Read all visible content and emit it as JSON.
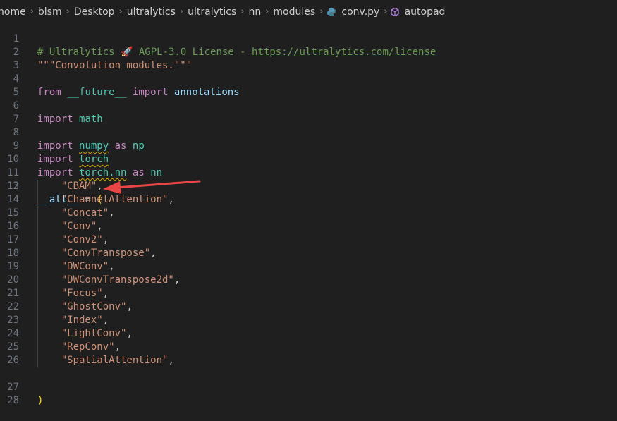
{
  "breadcrumb": {
    "items": [
      "home",
      "blsm",
      "Desktop",
      "ultralytics",
      "ultralytics",
      "nn",
      "modules"
    ],
    "file": "conv.py",
    "symbol": "autopad"
  },
  "editor": {
    "line_numbers": [
      "1",
      "2",
      "3",
      "4",
      "5",
      "6",
      "7",
      "8",
      "9",
      "10",
      "11",
      "12",
      "13",
      "14",
      "15",
      "16",
      "17",
      "18",
      "19",
      "20",
      "21",
      "22",
      "23",
      "24",
      "25",
      "26",
      "27",
      "28"
    ],
    "line1": {
      "comment_a": "# Ultralytics ",
      "emoji": "🚀",
      "comment_b": " AGPL-3.0 License - ",
      "url": "https://ultralytics.com/license"
    },
    "line2": {
      "docstring": "\"\"\"Convolution modules.\"\"\""
    },
    "line4": {
      "kw1": "from",
      "module": "__future__",
      "kw2": "import",
      "name": "annotations"
    },
    "line6": {
      "kw": "import",
      "module": "math"
    },
    "line8": {
      "kw": "import",
      "module": "numpy",
      "as": "as",
      "alias": "np"
    },
    "line9": {
      "kw": "import",
      "module": "torch"
    },
    "line10": {
      "kw": "import",
      "module": "torch.nn",
      "as": "as",
      "alias": "nn"
    },
    "line12": {
      "var": "__all__",
      "eq": " = ",
      "open": "("
    },
    "all_items": [
      "\"CBAM\"",
      "\"ChannelAttention\"",
      "\"Concat\"",
      "\"Conv\"",
      "\"Conv2\"",
      "\"ConvTranspose\"",
      "\"DWConv\"",
      "\"DWConvTranspose2d\"",
      "\"Focus\"",
      "\"GhostConv\"",
      "\"Index\"",
      "\"LightConv\"",
      "\"RepConv\"",
      "\"SpatialAttention\""
    ],
    "comma": ",",
    "close": ")"
  },
  "colors": {
    "arrow": "#e84545",
    "background": "#1f1f1f"
  }
}
